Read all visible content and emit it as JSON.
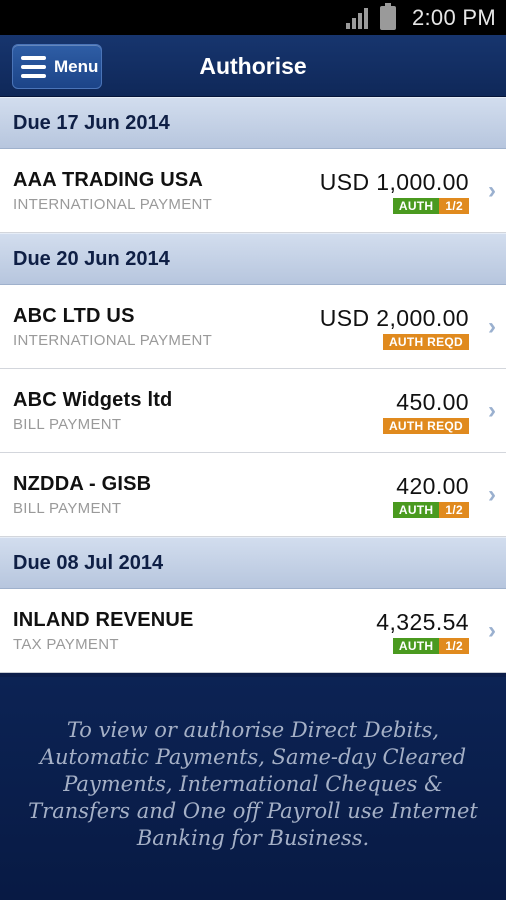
{
  "status_bar": {
    "time": "2:00 PM"
  },
  "header": {
    "menu_label": "Menu",
    "title": "Authorise"
  },
  "sections": [
    {
      "due": "Due 17 Jun 2014",
      "items": [
        {
          "payee": "AAA TRADING USA",
          "type": "INTERNATIONAL PAYMENT",
          "amount": "USD 1,000.00",
          "badge_auth": "AUTH",
          "badge_count": "1/2"
        }
      ]
    },
    {
      "due": "Due 20 Jun 2014",
      "items": [
        {
          "payee": "ABC LTD US",
          "type": "INTERNATIONAL PAYMENT",
          "amount": "USD 2,000.00",
          "badge_reqd": "AUTH REQD"
        },
        {
          "payee": "ABC Widgets ltd",
          "type": "BILL PAYMENT",
          "amount": "450.00",
          "badge_reqd": "AUTH REQD"
        },
        {
          "payee": "NZDDA - GISB",
          "type": "BILL PAYMENT",
          "amount": "420.00",
          "badge_auth": "AUTH",
          "badge_count": "1/2"
        }
      ]
    },
    {
      "due": "Due 08 Jul 2014",
      "items": [
        {
          "payee": "INLAND REVENUE",
          "type": "TAX PAYMENT",
          "amount": "4,325.54",
          "badge_auth": "AUTH",
          "badge_count": "1/2"
        }
      ]
    }
  ],
  "footer": {
    "message": "To view or authorise Direct Debits, Automatic Payments, Same-day Cleared Payments, International Cheques & Transfers and One off Payroll use Internet Banking for Business."
  },
  "colors": {
    "header_bg": "#17356e",
    "section_bg": "#c3d0e6",
    "auth_green": "#4a9a1f",
    "auth_orange": "#e08a1e",
    "footer_bg": "#0b1d4a"
  }
}
